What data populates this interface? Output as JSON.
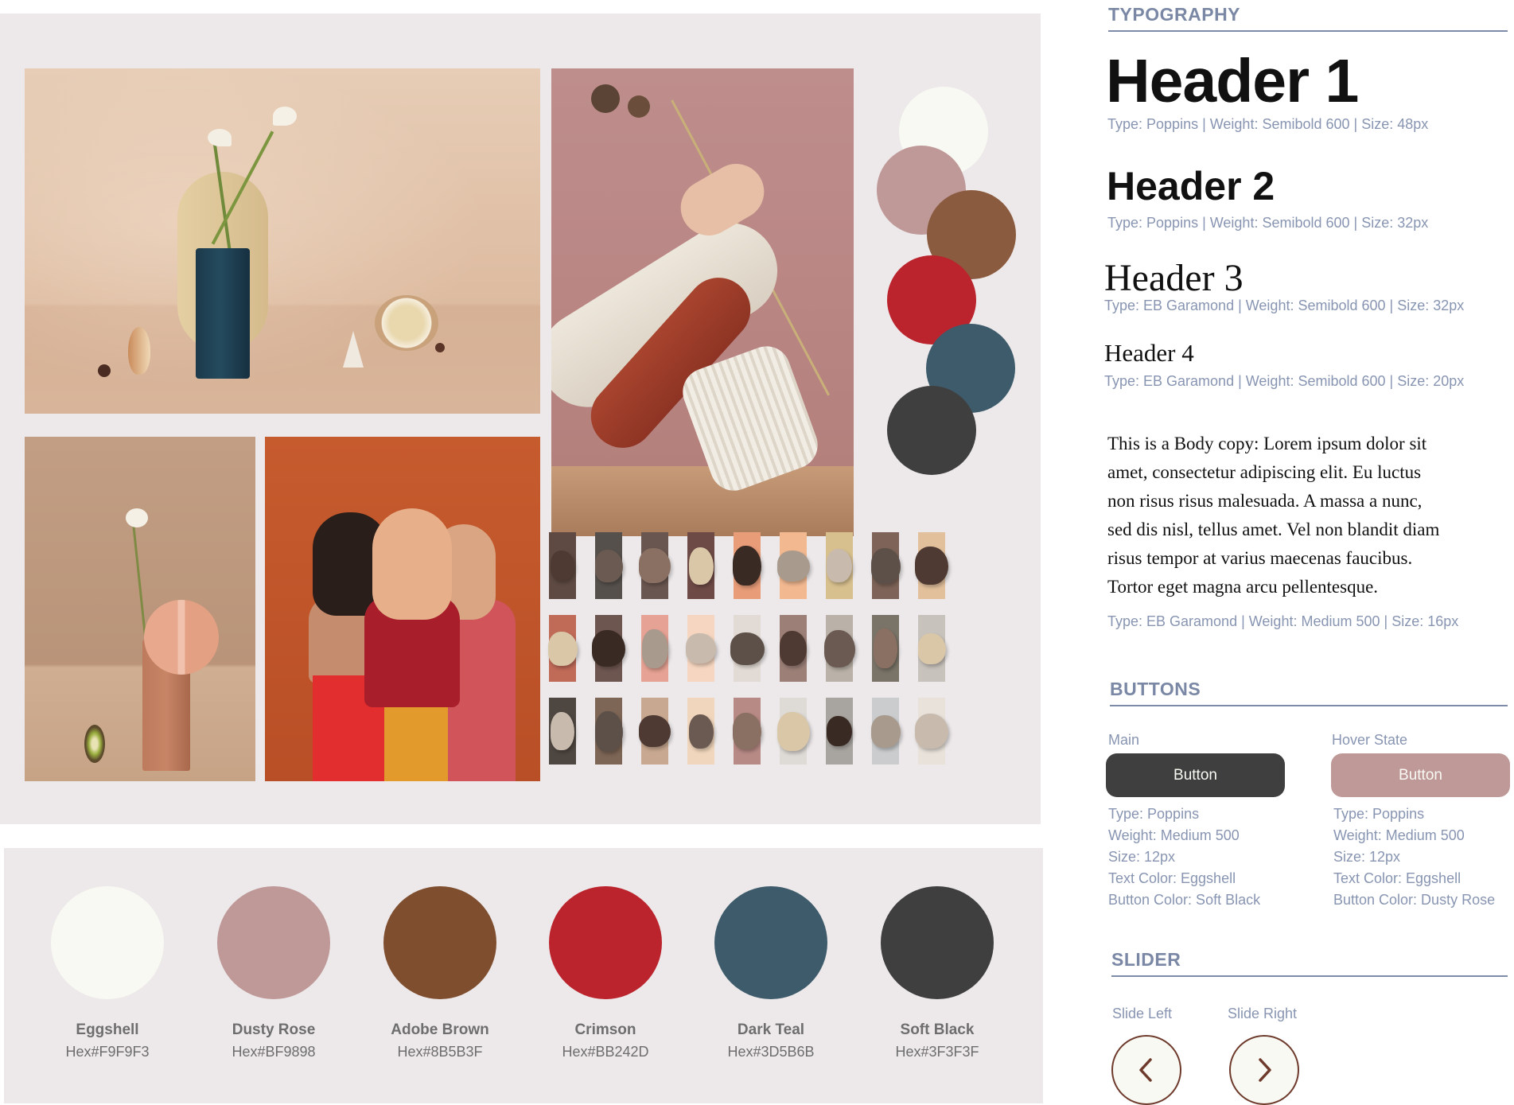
{
  "typography": {
    "title": "TYPOGRAPHY",
    "h1": {
      "text": "Header 1",
      "meta": "Type: Poppins | Weight: Semibold 600 | Size: 48px"
    },
    "h2": {
      "text": "Header 2",
      "meta": "Type: Poppins | Weight: Semibold 600 | Size: 32px"
    },
    "h3": {
      "text": "Header 3",
      "meta": "Type: EB Garamond | Weight: Semibold 600 | Size: 32px"
    },
    "h4": {
      "text": "Header 4",
      "meta": "Type: EB Garamond | Weight: Semibold 600 | Size: 20px"
    },
    "body": {
      "lines": [
        "This is a Body copy: Lorem ipsum dolor sit",
        "amet, consectetur adipiscing elit. Eu luctus",
        "non risus risus malesuada. A massa a nunc,",
        "sed dis nisl, tellus amet. Vel non blandit diam",
        "risus tempor at varius maecenas faucibus.",
        "Tortor eget magna arcu pellentesque."
      ],
      "meta": "Type: EB Garamond | Weight: Medium 500 | Size: 16px"
    }
  },
  "buttons": {
    "title": "BUTTONS",
    "main": {
      "label": "Main",
      "button_text": "Button",
      "color": "#3F3F3F",
      "specs": [
        "Type: Poppins",
        "Weight: Medium 500",
        "Size: 12px",
        "Text Color: Eggshell",
        "Button Color: Soft Black"
      ]
    },
    "hover": {
      "label": "Hover State",
      "button_text": "Button",
      "color": "#BF9898",
      "specs": [
        "Type: Poppins",
        "Weight: Medium 500",
        "Size: 12px",
        "Text Color: Eggshell",
        "Button Color: Dusty Rose"
      ]
    }
  },
  "slider": {
    "title": "SLIDER",
    "left_label": "Slide Left",
    "right_label": "Slide Right",
    "left_icon": "chevron-left-icon",
    "right_icon": "chevron-right-icon"
  },
  "palette": [
    {
      "name": "Eggshell",
      "hex": "Hex#F9F9F3",
      "color": "#F9F9F3"
    },
    {
      "name": "Dusty Rose",
      "hex": "Hex#BF9898",
      "color": "#BF9898"
    },
    {
      "name": "Adobe Brown",
      "hex": "Hex#8B5B3F",
      "color": "#7E4E2F"
    },
    {
      "name": "Crimson",
      "hex": "Hex#BB242D",
      "color": "#BB242D"
    },
    {
      "name": "Dark Teal",
      "hex": "Hex#3D5B6B",
      "color": "#3D5B6B"
    },
    {
      "name": "Soft Black",
      "hex": "Hex#3F3F3F",
      "color": "#3F3F3F"
    }
  ],
  "moodboard": {
    "photos": [
      "vase-still-life-photo",
      "hands-dried-flowers-photo",
      "peach-sculpture-photo",
      "three-women-photo",
      "stone-swatches-grid"
    ],
    "stone_colors": [
      [
        "#5E4A42",
        "#56504C",
        "#6A5650",
        "#6E4A46",
        "#E89C78",
        "#F2B890",
        "#D8C08E",
        "#7E6458",
        "#E2C09C"
      ],
      [
        "#C06A58",
        "#6E5650",
        "#E6A294",
        "#F6D6C0",
        "#E2DAD4",
        "#9C8078",
        "#BAB2A8",
        "#7A7468",
        "#C8C2BC"
      ],
      [
        "#4E4640",
        "#7E6656",
        "#C8A890",
        "#F0D6BC",
        "#B88A86",
        "#DEDAD6",
        "#A8A4A0",
        "#CACCCE",
        "#E8E2DA"
      ]
    ]
  }
}
